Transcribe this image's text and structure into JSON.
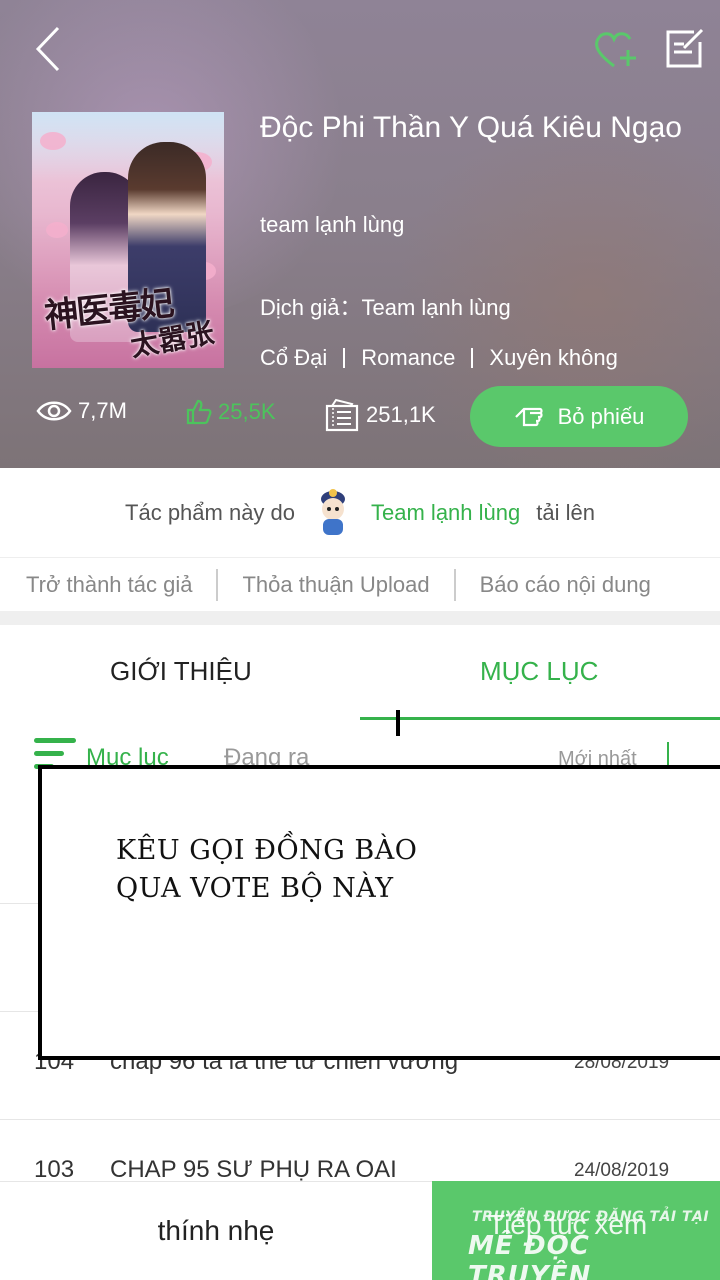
{
  "header": {
    "title": "Độc Phi Thần Y Quá Kiêu Ngạo",
    "subtitle": "team lạnh lùng",
    "translator": "Dịch giả：Team lạnh lùng",
    "genres": [
      "Cổ Đại",
      "Romance",
      "Xuyên không"
    ],
    "cover_text": {
      "main": "神医毒妃",
      "sub": "太嚣张"
    },
    "stats": {
      "views": "7,7M",
      "likes": "25,5K",
      "tickets": "251,1K"
    },
    "vote_label": "Bỏ phiếu"
  },
  "uploader": {
    "prefix": "Tác phẩm này do",
    "team": "Team lạnh lùng",
    "suffix": "tải lên"
  },
  "links": [
    "Trở thành tác giả",
    "Thỏa thuận Upload",
    "Báo cáo nội dung"
  ],
  "tabs": {
    "intro": "GIỚI THIỆU",
    "toc": "MỤC LỤC",
    "active": "toc"
  },
  "toc_bar": {
    "label": "Mục lục",
    "status": "Đang ra",
    "sort": "Mới nhất"
  },
  "chapters": [
    {
      "num": "104",
      "name": "chap 96 ta là thế tử chiến vương",
      "date": "28/08/2019"
    },
    {
      "num": "103",
      "name": "CHAP 95 SƯ PHỤ RA OAI",
      "date": "24/08/2019"
    }
  ],
  "note": {
    "line1": "KÊU GỌI ĐỒNG BÀO",
    "line2": "QUA VOTE BỘ NÀY"
  },
  "bottom": {
    "left_label": "thính nhẹ",
    "right_label": "Tiếp tục xem",
    "watermark_small": "TRUYỆN ĐƯỢC ĐĂNG TẢI TẠI",
    "watermark_big": "MÊ ĐỌC TRUYỆN"
  },
  "colors": {
    "accent": "#35b24b",
    "button_green": "#5ac86b",
    "header_bg": "#8a7f8c"
  },
  "icons": [
    "back-arrow-icon",
    "heart-plus-icon",
    "edit-icon",
    "eye-icon",
    "thumb-up-icon",
    "ticket-icon",
    "vote-hand-icon",
    "menu-icon"
  ]
}
